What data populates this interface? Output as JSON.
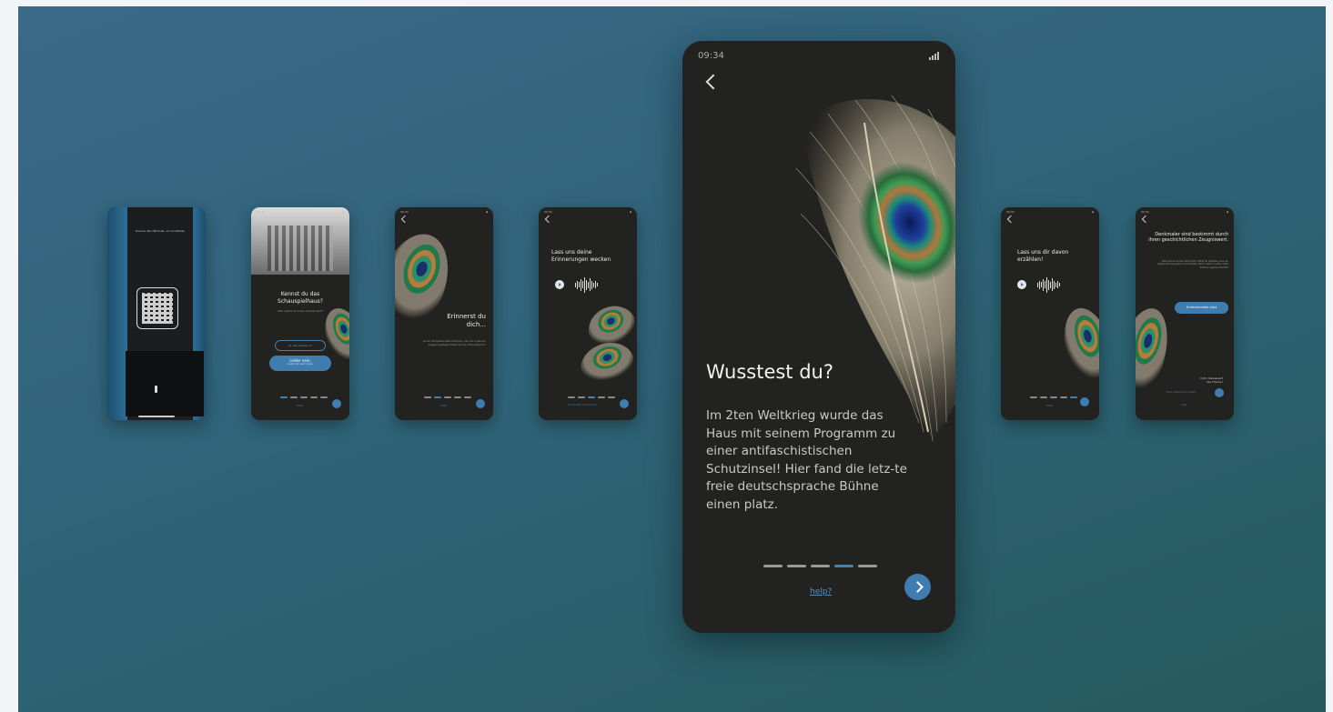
{
  "colors": {
    "accent": "#3f7cb0",
    "screen_bg": "#222220",
    "text": "#f1f1f1"
  },
  "screens": {
    "s1": {
      "hint": "Scanne den QR-Code, um zu starten"
    },
    "s2": {
      "status_time": "09:34",
      "title": "Kennst du das Schauspielhaus?",
      "subtitle": "oder warst du schon einmal dort?",
      "opt1": "Ja, das kenne ich",
      "opt2_main": "Leider nein,",
      "opt2_sub": "erzähl mir mehr davon",
      "help": "help"
    },
    "s3": {
      "status_time": "09:34",
      "title": "Erinnerst du dich...",
      "body": "an all die bekannten Dramen, die du in deiner Jugend gelesen hast und an ihre Autoren?",
      "help": "help"
    },
    "s4": {
      "status_time": "09:34",
      "title": "Lass uns deine Erinnerungen wecken",
      "help": "Ich möchte nicht zuhören"
    },
    "s6": {
      "status_time": "09:34",
      "title": "Lass uns dir davon erzählen!",
      "help": "help"
    },
    "s7": {
      "status_time": "09:34",
      "title": "Denkmaler sind bestimmt durch ihren geschichtlichen Zeugniswert.",
      "body": "Jetzt kennst du die Geschichte. Willst du erfahren, was der Mauerrest ausgraben und erhalten wird? Lebend nichts, mehr Kraft im eigenen Porträt!",
      "button": "Unterschreibe jetzt",
      "more1": "Dich interessiert",
      "more2": "das Thema?",
      "more_link": "Hier erfährst du mehr",
      "help": "help"
    },
    "main": {
      "status_time": "09:34",
      "heading": "Wusstest du?",
      "body": "Im 2ten Weltkrieg wurde das Haus mit seinem Programm zu einer antifaschistischen Schutzinsel! Hier fand die letz-te freie deutschsprache Bühne einen platz.",
      "help": "help?",
      "progress": {
        "total": 5,
        "active": 4
      }
    }
  }
}
